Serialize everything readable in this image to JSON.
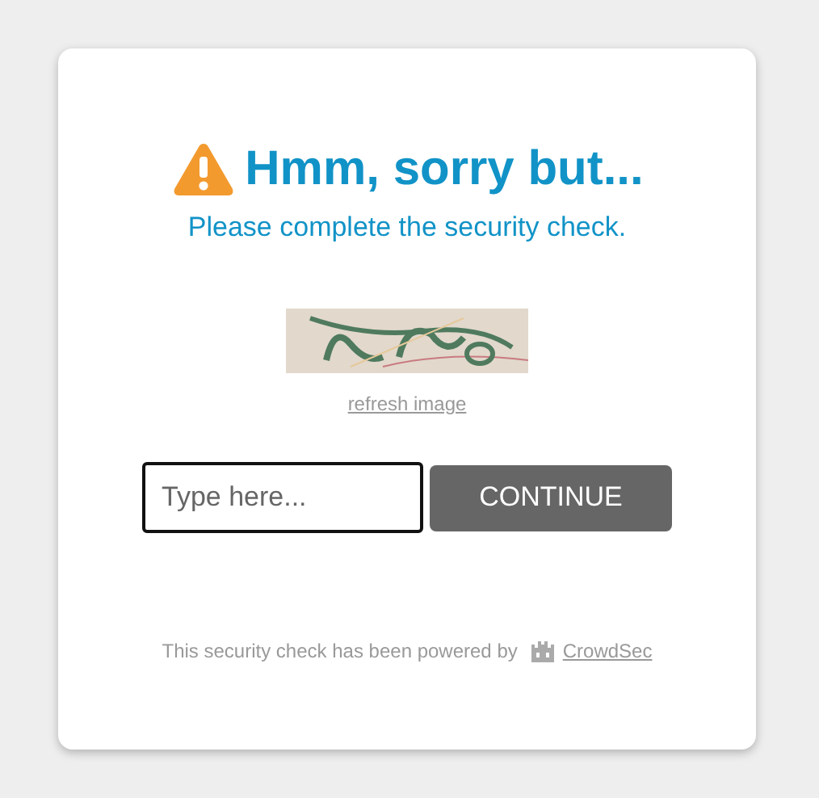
{
  "title": "Hmm, sorry but...",
  "subtitle": "Please complete the security check.",
  "refresh_link": "refresh image",
  "answer_field": {
    "placeholder": "Type here..."
  },
  "submit_button": "CONTINUE",
  "footer": {
    "text": "This security check has been powered by",
    "link": "CrowdSec"
  }
}
